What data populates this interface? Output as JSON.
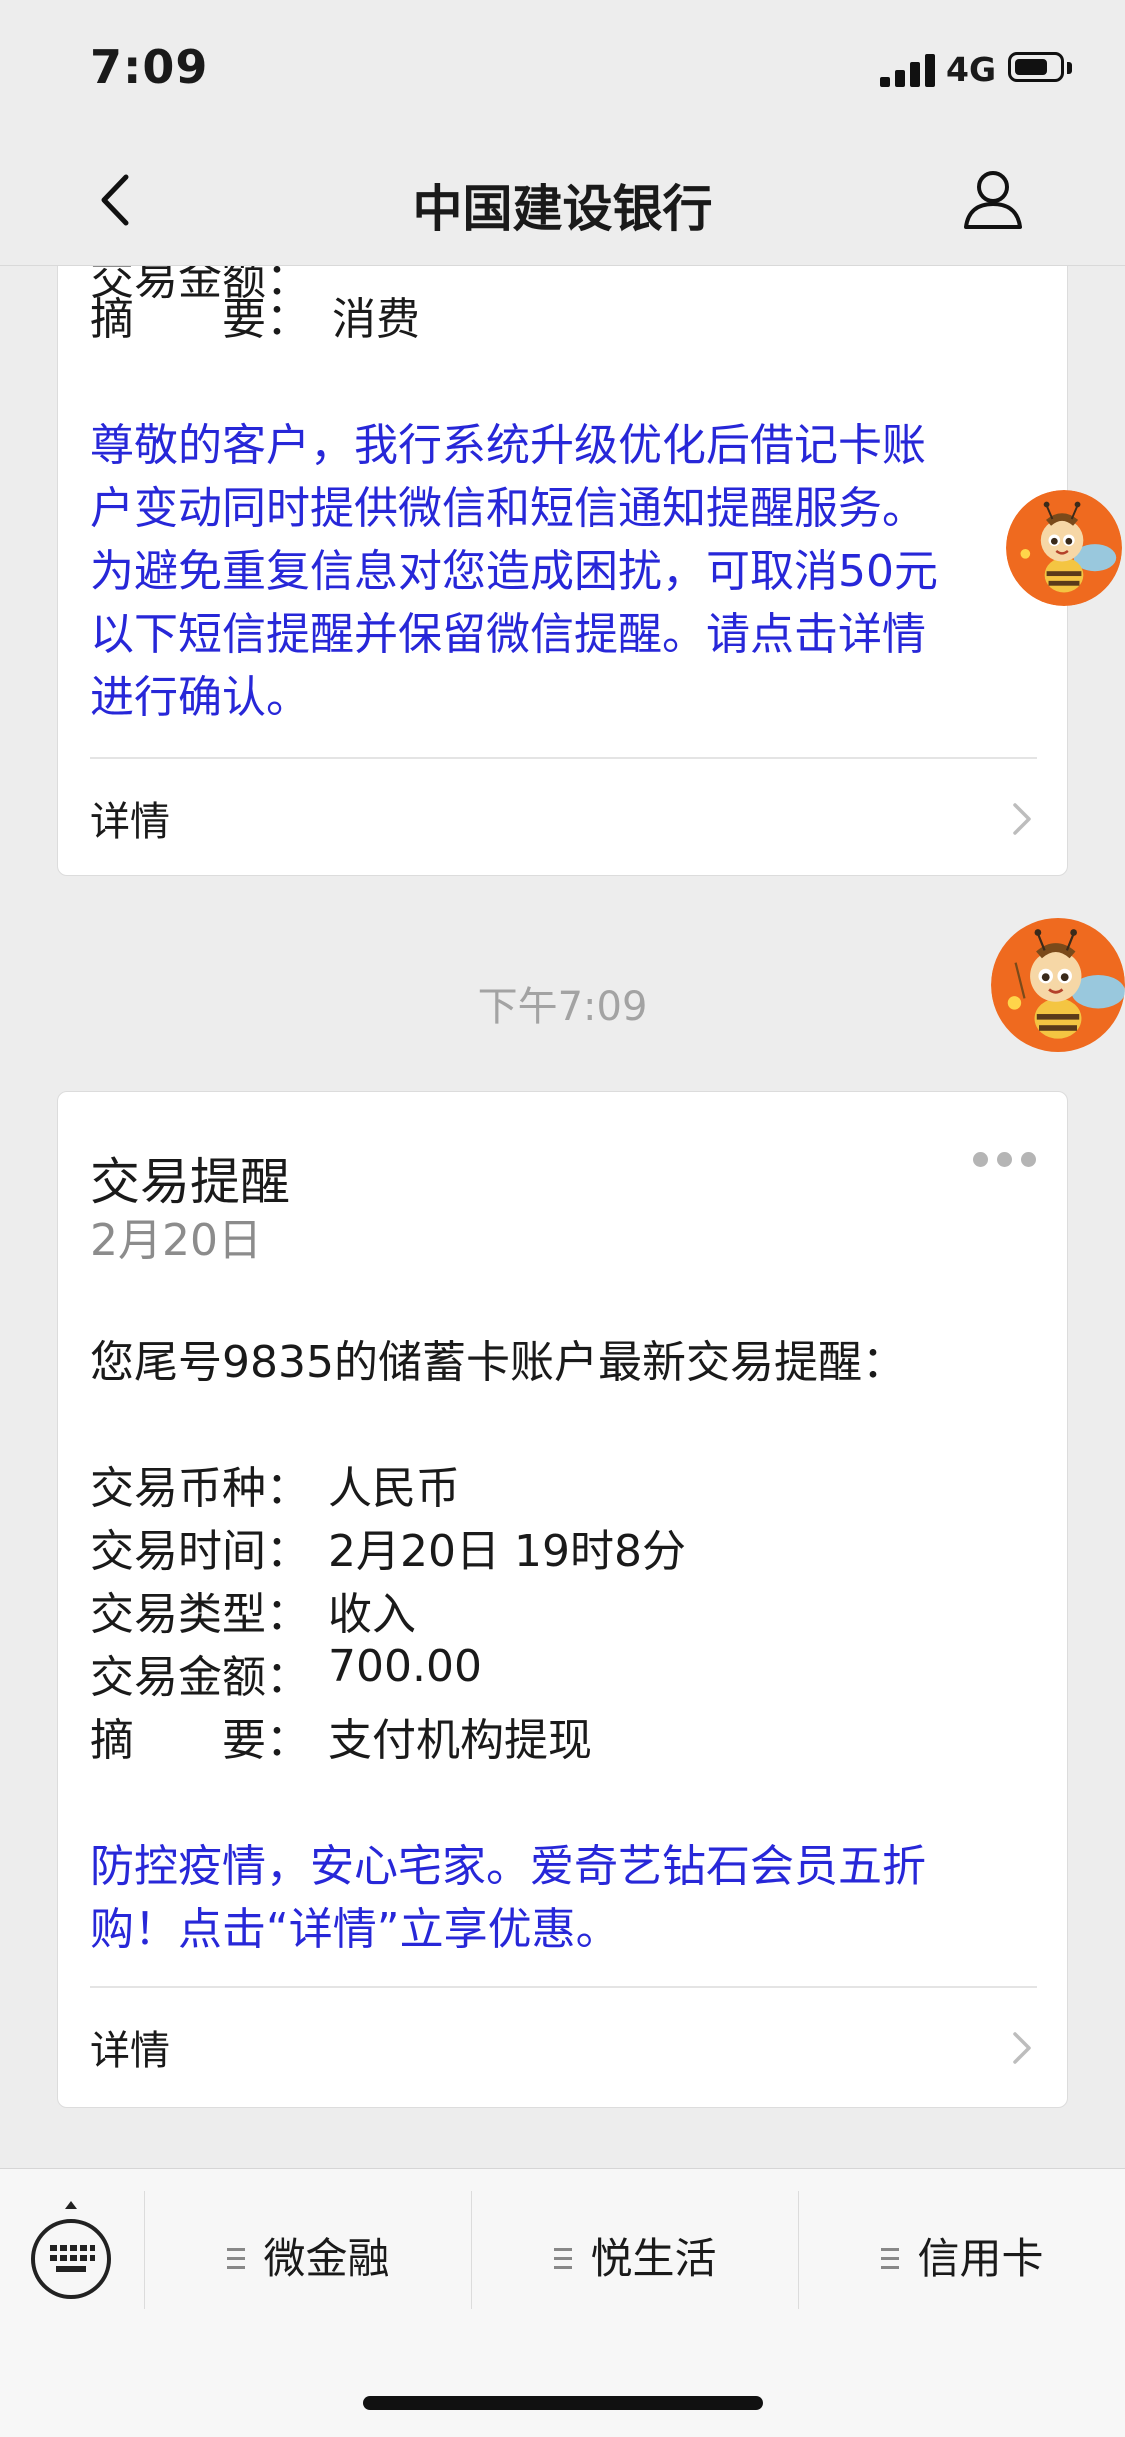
{
  "status_bar": {
    "time": "7:09",
    "network": "4G"
  },
  "nav": {
    "title": "中国建设银行",
    "back_icon": "chevron-left-icon",
    "profile_icon": "user-icon"
  },
  "card1": {
    "cut_line": "交易金额：",
    "summary_label": "摘　　要：",
    "summary_value": "消费",
    "notice_lines": [
      "尊敬的客户，我行系统升级优化后借记卡账",
      "户变动同时提供微信和短信通知提醒服务。",
      "为避免重复信息对您造成困扰，可取消50元",
      "以下短信提醒并保留微信提醒。请点击详情",
      "进行确认。"
    ],
    "detail_label": "详情"
  },
  "timestamp": "下午7:09",
  "card2": {
    "title": "交易提醒",
    "date": "2月20日",
    "intro": "您尾号9835的储蓄卡账户最新交易提醒：",
    "fields": [
      {
        "label": "交易币种：",
        "value": "人民币"
      },
      {
        "label": "交易时间：",
        "value": "2月20日 19时8分"
      },
      {
        "label": "交易类型：",
        "value": "收入"
      },
      {
        "label": "交易金额：",
        "value": "700.00"
      },
      {
        "label": "摘　　要：",
        "value": "支付机构提现"
      }
    ],
    "promo_lines": [
      "防控疫情，安心宅家。爱奇艺钻石会员五折",
      "购！点击“详情”立享优惠。"
    ],
    "detail_label": "详情"
  },
  "bottom_menu": {
    "items": [
      {
        "label": "微金融"
      },
      {
        "label": "悦生活"
      },
      {
        "label": "信用卡"
      }
    ],
    "keyboard_icon": "keyboard-icon"
  },
  "colors": {
    "link_blue": "#2727d8",
    "mascot_orange": "#ef6a1f"
  }
}
